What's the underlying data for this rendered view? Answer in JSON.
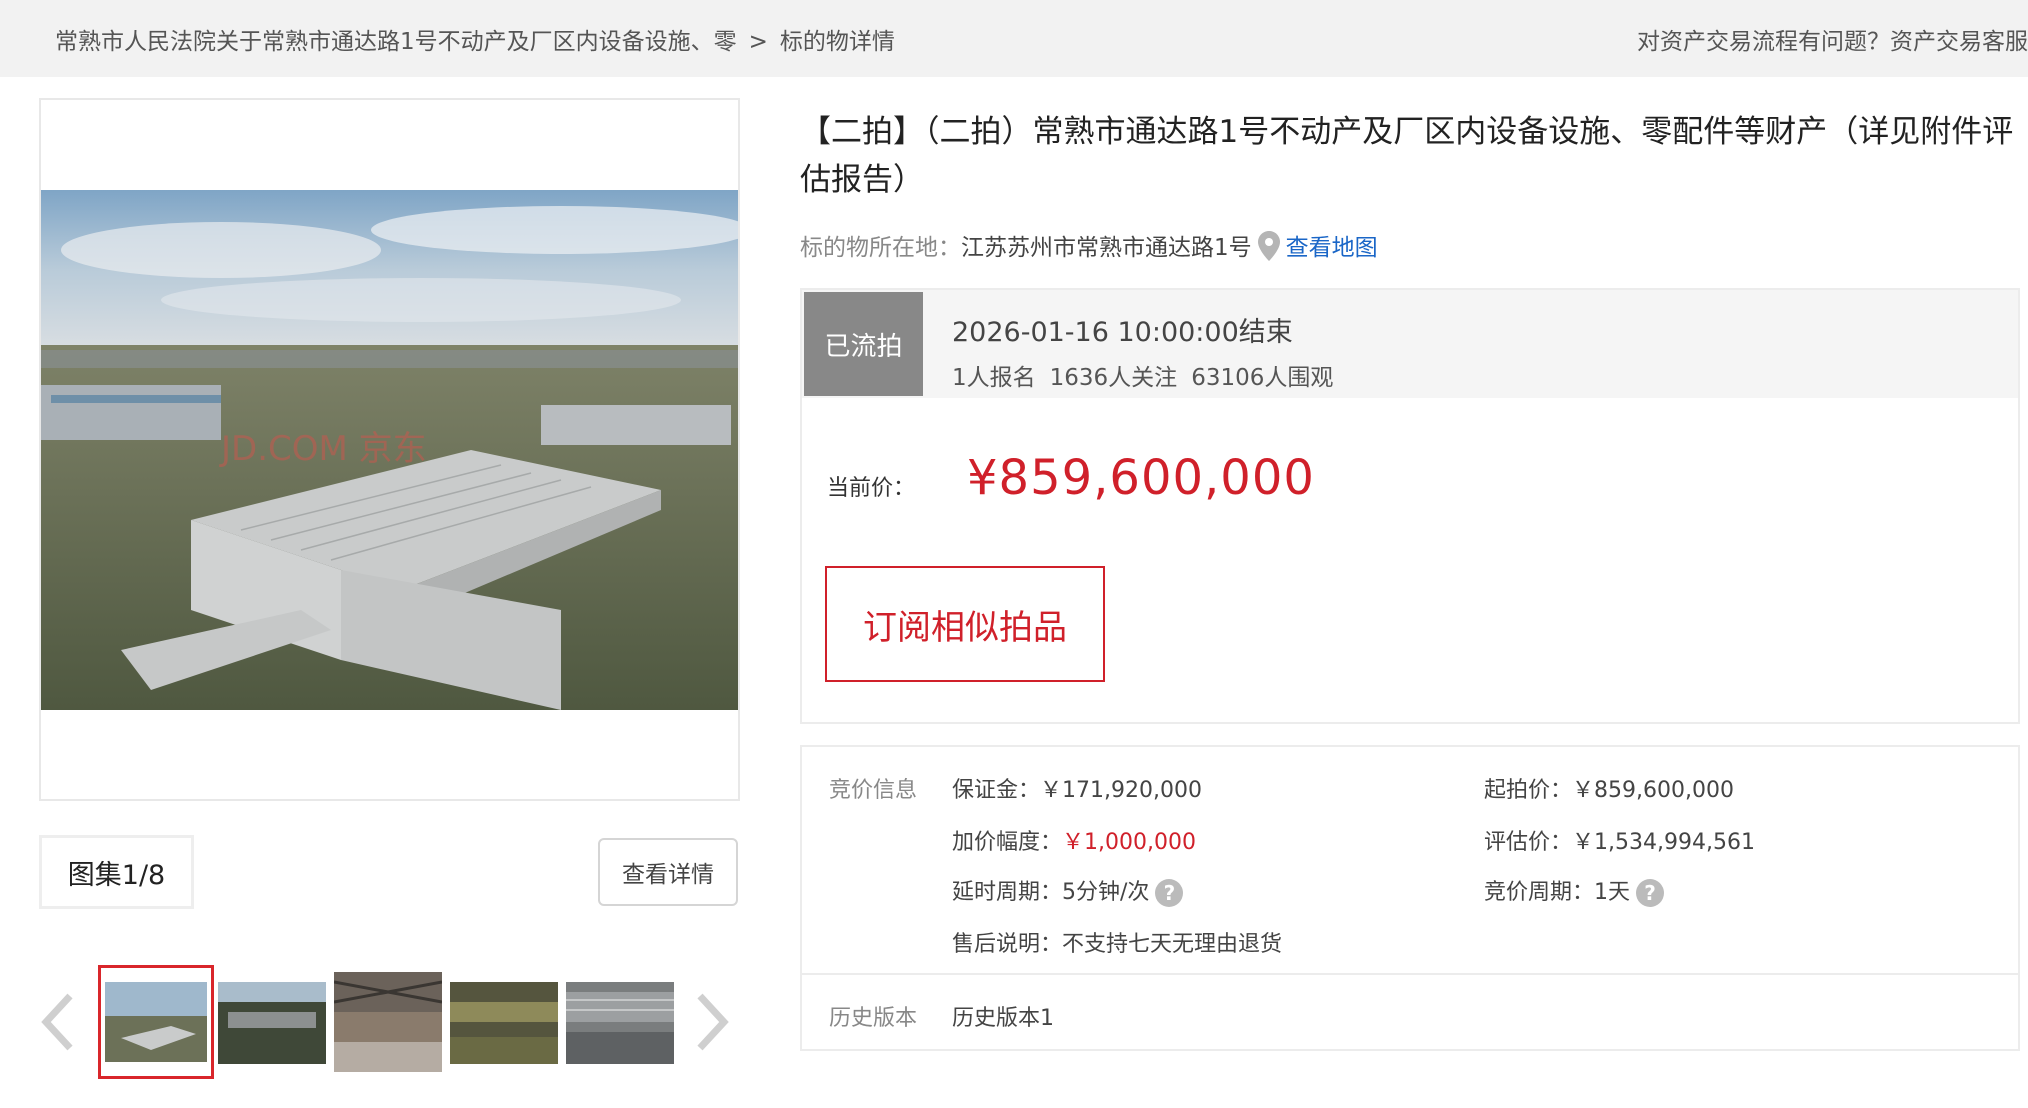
{
  "breadcrumb": {
    "parent": "常熟市人民法院关于常熟市通达路1号不动产及厂区内设备设施、零",
    "separator": ">",
    "current": "标的物详情"
  },
  "help_text": "对资产交易流程有问题？资产交易客服",
  "gallery": {
    "count_label": "图集1/8",
    "view_detail_label": "查看详情",
    "watermark": "JD.COM 京东"
  },
  "title": "【二拍】（二拍）常熟市通达路1号不动产及厂区内设备设施、零配件等财产（详见附件评估报告）",
  "location": {
    "label": "标的物所在地：",
    "address": "江苏苏州市常熟市通达路1号",
    "map_link": "查看地图"
  },
  "status": {
    "tag": "已流拍",
    "end_time": "2026-01-16 10:00:00结束",
    "signups": "1人报名",
    "followers": "1636人关注",
    "viewers": "63106人围观"
  },
  "price": {
    "label": "当前价：",
    "value": "¥859,600,000"
  },
  "subscribe_label": "订阅相似拍品",
  "bid_info": {
    "section_label": "竞价信息",
    "deposit_label": "保证金：",
    "deposit_value": "￥171,920,000",
    "start_price_label": "起拍价：",
    "start_price_value": "￥859,600,000",
    "increment_label": "加价幅度：",
    "increment_value": "￥1,000,000",
    "appraisal_label": "评估价：",
    "appraisal_value": "￥1,534,994,561",
    "delay_label": "延时周期：",
    "delay_value": "5分钟/次",
    "cycle_label": "竞价周期：",
    "cycle_value": "1天",
    "after_sale_label": "售后说明：",
    "after_sale_value": "不支持七天无理由退货"
  },
  "history": {
    "section_label": "历史版本",
    "version": "历史版本1"
  },
  "colors": {
    "accent_red": "#d0202a",
    "link_blue": "#1a66c7",
    "status_gray": "#888888"
  }
}
